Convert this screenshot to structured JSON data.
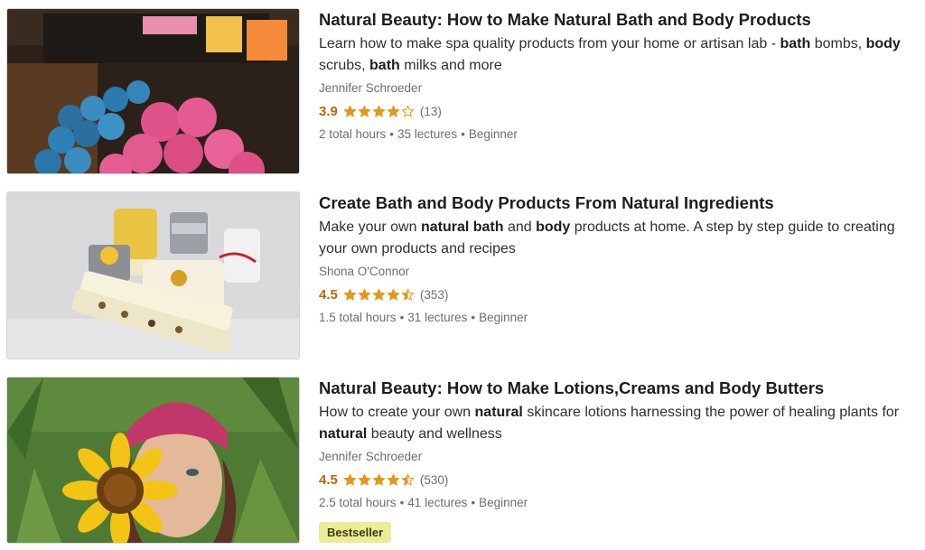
{
  "courses": [
    {
      "title": "Natural Beauty: How to Make Natural Bath and Body Products",
      "description_parts": [
        {
          "t": "Learn how to make spa quality products from your home or artisan lab - ",
          "b": false
        },
        {
          "t": "bath",
          "b": true
        },
        {
          "t": " bombs, ",
          "b": false
        },
        {
          "t": "body",
          "b": true
        },
        {
          "t": " scrubs, ",
          "b": false
        },
        {
          "t": "bath",
          "b": true
        },
        {
          "t": " milks and more",
          "b": false
        }
      ],
      "instructor": "Jennifer Schroeder",
      "rating": "3.9",
      "stars": 3.9,
      "reviews": "(13)",
      "hours": "2 total hours",
      "lectures": "35 lectures",
      "level": "Beginner",
      "thumbnail_icon": "bath-bombs-image"
    },
    {
      "title": "Create Bath and Body Products From Natural Ingredients",
      "description_parts": [
        {
          "t": "Make your own ",
          "b": false
        },
        {
          "t": "natural bath",
          "b": true
        },
        {
          "t": " and ",
          "b": false
        },
        {
          "t": "body",
          "b": true
        },
        {
          "t": " products at home. A step by step guide to creating your own products and recipes",
          "b": false
        }
      ],
      "instructor": "Shona O'Connor",
      "rating": "4.5",
      "stars": 4.5,
      "reviews": "(353)",
      "hours": "1.5 total hours",
      "lectures": "31 lectures",
      "level": "Beginner",
      "thumbnail_icon": "bath-products-jars-image"
    },
    {
      "title": "Natural Beauty: How to Make Lotions,Creams and Body Butters",
      "description_parts": [
        {
          "t": "How to create your own ",
          "b": false
        },
        {
          "t": "natural",
          "b": true
        },
        {
          "t": " skincare lotions harnessing the power of healing plants for ",
          "b": false
        },
        {
          "t": "natural",
          "b": true
        },
        {
          "t": " beauty and wellness",
          "b": false
        }
      ],
      "instructor": "Jennifer Schroeder",
      "rating": "4.5",
      "stars": 4.5,
      "reviews": "(530)",
      "hours": "2.5 total hours",
      "lectures": "41 lectures",
      "level": "Beginner",
      "badge": "Bestseller",
      "thumbnail_icon": "sunflower-woman-image"
    }
  ],
  "colors": {
    "star": "#e59819",
    "rating_text": "#b4690e",
    "badge_bg": "#eceb98"
  }
}
